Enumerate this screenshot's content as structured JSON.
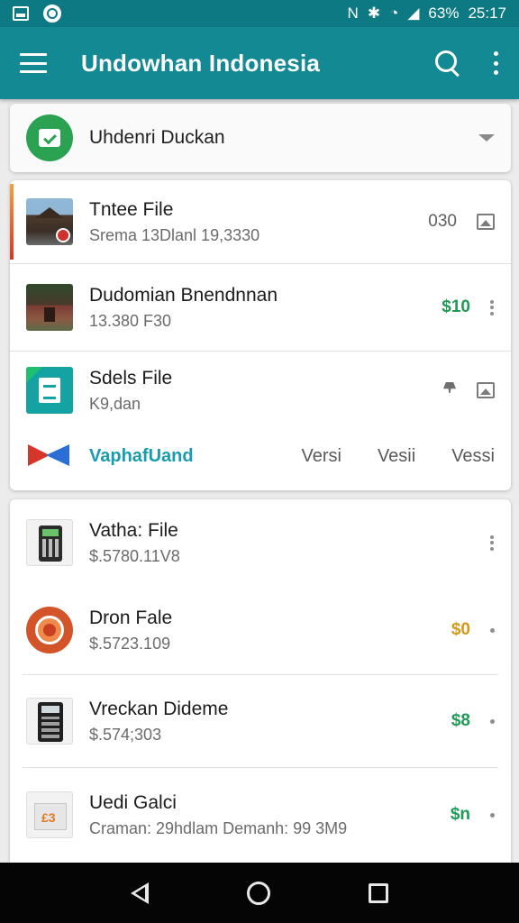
{
  "status_bar": {
    "battery": "63%",
    "time": "25:17"
  },
  "app_bar": {
    "title": "Undowhan Indonesia"
  },
  "account": {
    "label": "Uhdenri Duckan"
  },
  "card_a": {
    "rows": [
      {
        "title": "Tntee File",
        "subtitle": "Srema 13Dlanl 19,3330",
        "value": "030"
      },
      {
        "title": "Dudomian Bnendnnan",
        "subtitle": "13.380 F30",
        "value": "$10"
      },
      {
        "title": "Sdels File",
        "subtitle": "K9,dan"
      }
    ],
    "tabs": {
      "brand": "VaphafUand",
      "items": [
        "Versi",
        "Vesii",
        "Vessi"
      ]
    }
  },
  "card_b": {
    "rows": [
      {
        "title": "Vatha: File",
        "subtitle": "$.5780.11V8"
      },
      {
        "title": "Dron Fale",
        "subtitle": "$.5723.109",
        "value": "$0"
      },
      {
        "title": "Vreckan Dideme",
        "subtitle": "$.574;303",
        "value": "$8"
      },
      {
        "title": "Uedi Galci",
        "subtitle": "Craman: 29hdlam Demanh: 99 3M9",
        "value": "$n"
      }
    ]
  },
  "colors": {
    "appbar": "#138993",
    "statusbar": "#0d7a83",
    "accent_green": "#1e9a55",
    "accent_gold": "#d39a18",
    "brand_teal": "#1a9cb0"
  }
}
